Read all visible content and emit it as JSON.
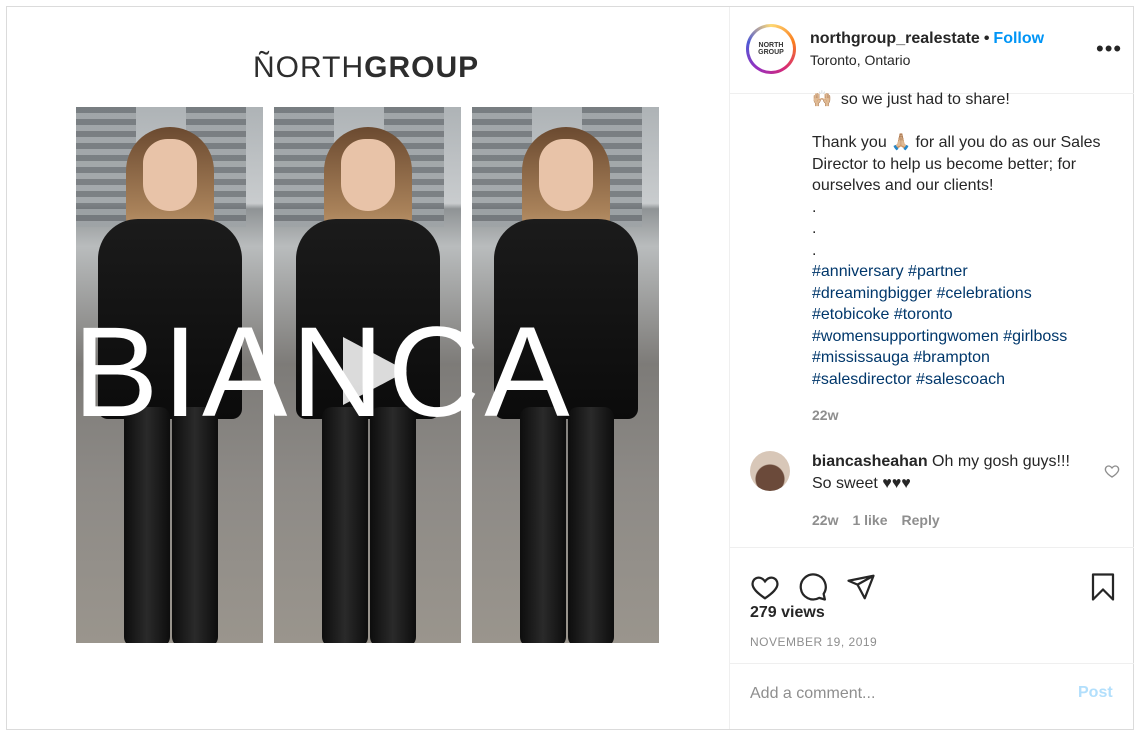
{
  "media": {
    "brand_prefix": "ÑORTH",
    "brand_suffix": "GROUP",
    "overlay_word": "BIANCA"
  },
  "header": {
    "avatar_text": "NORTH GROUP",
    "username": "northgroup_realestate",
    "separator": "•",
    "follow_label": "Follow",
    "location": "Toronto, Ontario",
    "more_label": "•••"
  },
  "caption": {
    "text": "🙌🏼  so we just had to share!\n\nThank you 🙏🏼 for all you do as our Sales Director to help us become better; for ourselves and our clients!\n.\n.\n.",
    "hashtags": "#anniversary #partner\n#dreamingbigger #celebrations\n#etobicoke #toronto\n#womensupportingwomen #girlboss\n#mississauga #brampton\n#salesdirector #salescoach",
    "time": "22w"
  },
  "comment": {
    "username": "biancasheahan",
    "text": " Oh my gosh guys!!! So sweet ♥♥♥",
    "time": "22w",
    "likes": "1 like",
    "reply_label": "Reply"
  },
  "actions": {
    "views": "279 views",
    "date": "NOVEMBER 19, 2019"
  },
  "add_comment": {
    "placeholder": "Add a comment...",
    "post_label": "Post"
  },
  "colors": {
    "accent": "#0095f6",
    "hashtag": "#00376b",
    "muted": "#8e8e8e",
    "post_disabled": "#b2dffc"
  },
  "icons": [
    "heart-icon",
    "comment-icon",
    "share-icon",
    "bookmark-icon",
    "play-icon",
    "more-icon",
    "comment-like-icon"
  ]
}
